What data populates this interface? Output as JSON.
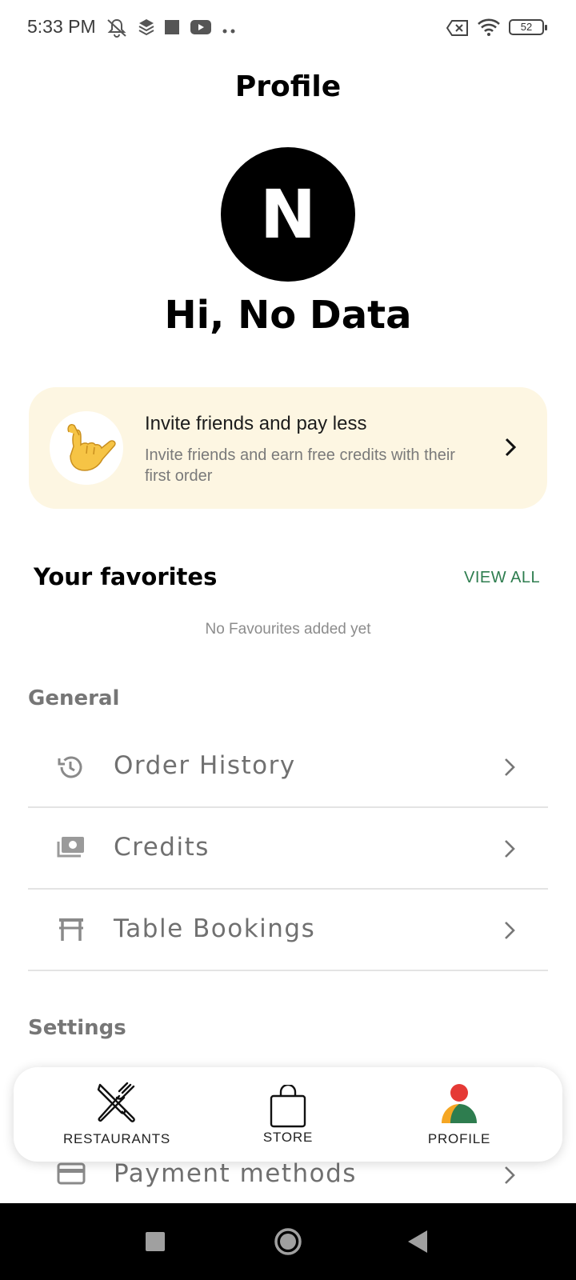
{
  "status_bar": {
    "time": "5:33 PM",
    "battery": "52",
    "icons": [
      "mute-icon",
      "layers-icon",
      "stop-icon",
      "youtube-icon",
      "more-icon",
      "no-sim-icon",
      "wifi-icon",
      "battery-icon"
    ]
  },
  "header": {
    "title": "Profile",
    "avatar_initial": "N",
    "greeting": "Hi, No Data"
  },
  "invite": {
    "title": "Invite friends and pay less",
    "subtitle": "Invite friends and earn free credits with their first order",
    "icon": "call-me-hand-emoji"
  },
  "favorites": {
    "title": "Your favorites",
    "view_all": "VIEW ALL",
    "empty_text": "No Favourites added yet"
  },
  "general": {
    "title": "General",
    "items": [
      {
        "label": "Order History",
        "icon": "history-icon"
      },
      {
        "label": "Credits",
        "icon": "cash-icon"
      },
      {
        "label": "Table Bookings",
        "icon": "table-icon"
      }
    ]
  },
  "settings": {
    "title": "Settings",
    "items": [
      {
        "label": "Payment methods",
        "icon": "credit-card-icon"
      }
    ]
  },
  "bottom_nav": {
    "items": [
      {
        "label": "RESTAURANTS",
        "icon": "fork-knife-icon"
      },
      {
        "label": "STORE",
        "icon": "shopping-bag-icon"
      },
      {
        "label": "PROFILE",
        "icon": "profile-icon",
        "active": true
      }
    ]
  },
  "colors": {
    "accent_green": "#2e7d4f",
    "invite_bg": "#fdf6e2",
    "profile_red": "#e53935",
    "profile_orange": "#f5a623",
    "profile_green": "#2e7d4f"
  }
}
